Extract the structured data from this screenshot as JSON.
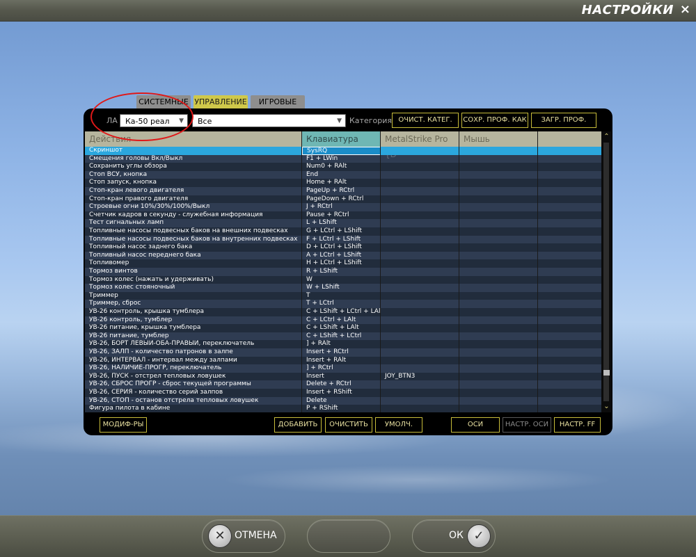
{
  "window": {
    "title": "НАСТРОЙКИ",
    "close_icon": "×"
  },
  "tabs": [
    {
      "label": "СИСТЕМНЫЕ",
      "active": false
    },
    {
      "label": "УПРАВЛЕНИЕ",
      "active": true
    },
    {
      "label": "ИГРОВЫЕ",
      "active": false
    }
  ],
  "filters": {
    "aircraft_label": "ЛА",
    "aircraft_value": "Ка-50 реал",
    "category_value": "Все",
    "category_label": "Категория"
  },
  "top_buttons": {
    "clear_category": "ОЧИСТ. КАТЕГ.",
    "save_profile_as": "СОХР. ПРОФ. КАК",
    "load_profile": "ЗАГР. ПРОФ."
  },
  "table": {
    "columns": [
      "Действия",
      "Клавиатура",
      "MetalStrike Pro {D",
      "Мышь"
    ],
    "rows": [
      {
        "action": "Скриншот",
        "keyboard": "SysRQ",
        "joystick": "",
        "mouse": ""
      },
      {
        "action": "Смещения головы Вкл/Выкл",
        "keyboard": "F1 + LWin",
        "joystick": "",
        "mouse": ""
      },
      {
        "action": "Сохранить углы обзора",
        "keyboard": "Num0 + RAlt",
        "joystick": "",
        "mouse": ""
      },
      {
        "action": "Стоп ВСУ, кнопка",
        "keyboard": "End",
        "joystick": "",
        "mouse": ""
      },
      {
        "action": "Стоп запуск, кнопка",
        "keyboard": "Home + RAlt",
        "joystick": "",
        "mouse": ""
      },
      {
        "action": "Стоп-кран левого двигателя",
        "keyboard": "PageUp + RCtrl",
        "joystick": "",
        "mouse": ""
      },
      {
        "action": "Стоп-кран правого двигателя",
        "keyboard": "PageDown + RCtrl",
        "joystick": "",
        "mouse": ""
      },
      {
        "action": "Строевые огни 10%/30%/100%/Выкл",
        "keyboard": "J + RCtrl",
        "joystick": "",
        "mouse": ""
      },
      {
        "action": "Счетчик кадров в секунду - служебная информация",
        "keyboard": "Pause + RCtrl",
        "joystick": "",
        "mouse": ""
      },
      {
        "action": "Тест сигнальных ламп",
        "keyboard": "L + LShift",
        "joystick": "",
        "mouse": ""
      },
      {
        "action": "Топливные насосы подвесных баков на внешних подвесках",
        "keyboard": "G + LCtrl + LShift",
        "joystick": "",
        "mouse": ""
      },
      {
        "action": "Топливные насосы подвесных баков на внутренних подвесках",
        "keyboard": "F + LCtrl + LShift",
        "joystick": "",
        "mouse": ""
      },
      {
        "action": "Топливный насос заднего бака",
        "keyboard": "D + LCtrl + LShift",
        "joystick": "",
        "mouse": ""
      },
      {
        "action": "Топливный насос переднего бака",
        "keyboard": "A + LCtrl + LShift",
        "joystick": "",
        "mouse": ""
      },
      {
        "action": "Топливомер",
        "keyboard": "H + LCtrl + LShift",
        "joystick": "",
        "mouse": ""
      },
      {
        "action": "Тормоз винтов",
        "keyboard": "R + LShift",
        "joystick": "",
        "mouse": ""
      },
      {
        "action": "Тормоз колес (нажать и удерживать)",
        "keyboard": "W",
        "joystick": "",
        "mouse": ""
      },
      {
        "action": "Тормоз колес стояночный",
        "keyboard": "W + LShift",
        "joystick": "",
        "mouse": ""
      },
      {
        "action": "Триммер",
        "keyboard": "T",
        "joystick": "",
        "mouse": ""
      },
      {
        "action": "Триммер, сброс",
        "keyboard": "T + LCtrl",
        "joystick": "",
        "mouse": ""
      },
      {
        "action": "УВ-26 контроль, крышка тумблера",
        "keyboard": "C + LShift + LCtrl + LAlt",
        "joystick": "",
        "mouse": ""
      },
      {
        "action": "УВ-26 контроль, тумблер",
        "keyboard": "C + LCtrl + LAlt",
        "joystick": "",
        "mouse": ""
      },
      {
        "action": "УВ-26 питание, крышка тумблера",
        "keyboard": "C + LShift + LAlt",
        "joystick": "",
        "mouse": ""
      },
      {
        "action": "УВ-26 питание, тумблер",
        "keyboard": "C + LShift + LCtrl",
        "joystick": "",
        "mouse": ""
      },
      {
        "action": "УВ-26, БОРТ ЛЕВЫЙ-ОБА-ПРАВЫЙ, переключатель",
        "keyboard": "] + RAlt",
        "joystick": "",
        "mouse": ""
      },
      {
        "action": "УВ-26, ЗАЛП - количество патронов в залпе",
        "keyboard": "Insert + RCtrl",
        "joystick": "",
        "mouse": ""
      },
      {
        "action": "УВ-26, ИНТЕРВАЛ - интервал между залпами",
        "keyboard": "Insert + RAlt",
        "joystick": "",
        "mouse": ""
      },
      {
        "action": "УВ-26, НАЛИЧИЕ-ПРОГР, переключатель",
        "keyboard": "] + RCtrl",
        "joystick": "",
        "mouse": ""
      },
      {
        "action": "УВ-26, ПУСК - отстрел тепловых ловушек",
        "keyboard": "Insert",
        "joystick": "JOY_BTN3",
        "mouse": ""
      },
      {
        "action": "УВ-26, СБРОС ПРОГР - сброс текущей программы",
        "keyboard": "Delete + RCtrl",
        "joystick": "",
        "mouse": ""
      },
      {
        "action": "УВ-26, СЕРИЯ - количество серий залпов",
        "keyboard": "Insert + RShift",
        "joystick": "",
        "mouse": ""
      },
      {
        "action": "УВ-26, СТОП - останов отстрела тепловых ловушек",
        "keyboard": "Delete",
        "joystick": "",
        "mouse": ""
      },
      {
        "action": "Фигура пилота в кабине",
        "keyboard": "P + RShift",
        "joystick": "",
        "mouse": ""
      }
    ]
  },
  "bottom_buttons": {
    "modifiers": "МОДИФ-РЫ",
    "add": "ДОБАВИТЬ",
    "clear": "ОЧИСТИТЬ",
    "default": "УМОЛЧ.",
    "axes": "ОСИ",
    "axis_settings": "НАСТР. ОСИ",
    "ff_settings": "НАСТР. FF"
  },
  "footer": {
    "cancel_label": "ОТМЕНА",
    "ok_label": "ОК",
    "cancel_icon": "✕",
    "ok_icon": "✓"
  },
  "colors": {
    "accent_yellow": "#cfc84a",
    "selected_row": "#2ba7de",
    "selected_column": "#6fb7b4",
    "annotation_red": "#e01818"
  }
}
